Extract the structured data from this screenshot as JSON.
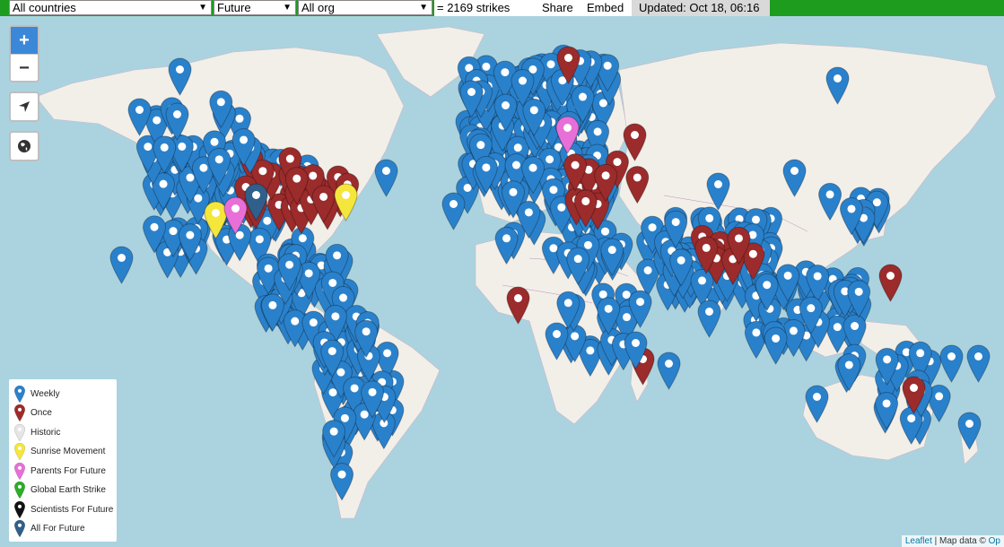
{
  "toolbar": {
    "country_select": "All countries",
    "time_select": "Future",
    "org_select": "All org",
    "strike_count": "= 2169 strikes",
    "share_label": "Share",
    "embed_label": "Embed",
    "updated": "Updated: Oct 18, 06:16"
  },
  "colors": {
    "toolbar_bg": "#1e9c1e",
    "water": "#aad3df",
    "land": "#f2efe9",
    "weekly": "#2a81cb",
    "once": "#9c2b2b",
    "historic": "#e5e5e5",
    "sunrise": "#f5e63b",
    "parents": "#e86fd7",
    "global_earth": "#2aad27",
    "scientists": "#111111",
    "all_for_future": "#2f5f8a"
  },
  "controls": {
    "zoom_in": "+",
    "zoom_out": "−"
  },
  "legend": [
    {
      "label": "Weekly",
      "color": "#2a81cb"
    },
    {
      "label": "Once",
      "color": "#9c2b2b"
    },
    {
      "label": "Historic",
      "color": "#e5e5e5"
    },
    {
      "label": "Sunrise Movement",
      "color": "#f5e63b"
    },
    {
      "label": "Parents For Future",
      "color": "#e86fd7"
    },
    {
      "label": "Global Earth Strike",
      "color": "#2aad27"
    },
    {
      "label": "Scientists For Future",
      "color": "#111111"
    },
    {
      "label": "All For Future",
      "color": "#2f5f8a"
    }
  ],
  "attribution": {
    "leaflet": "Leaflet",
    "separator": " | Map data © ",
    "osm": "Op"
  }
}
